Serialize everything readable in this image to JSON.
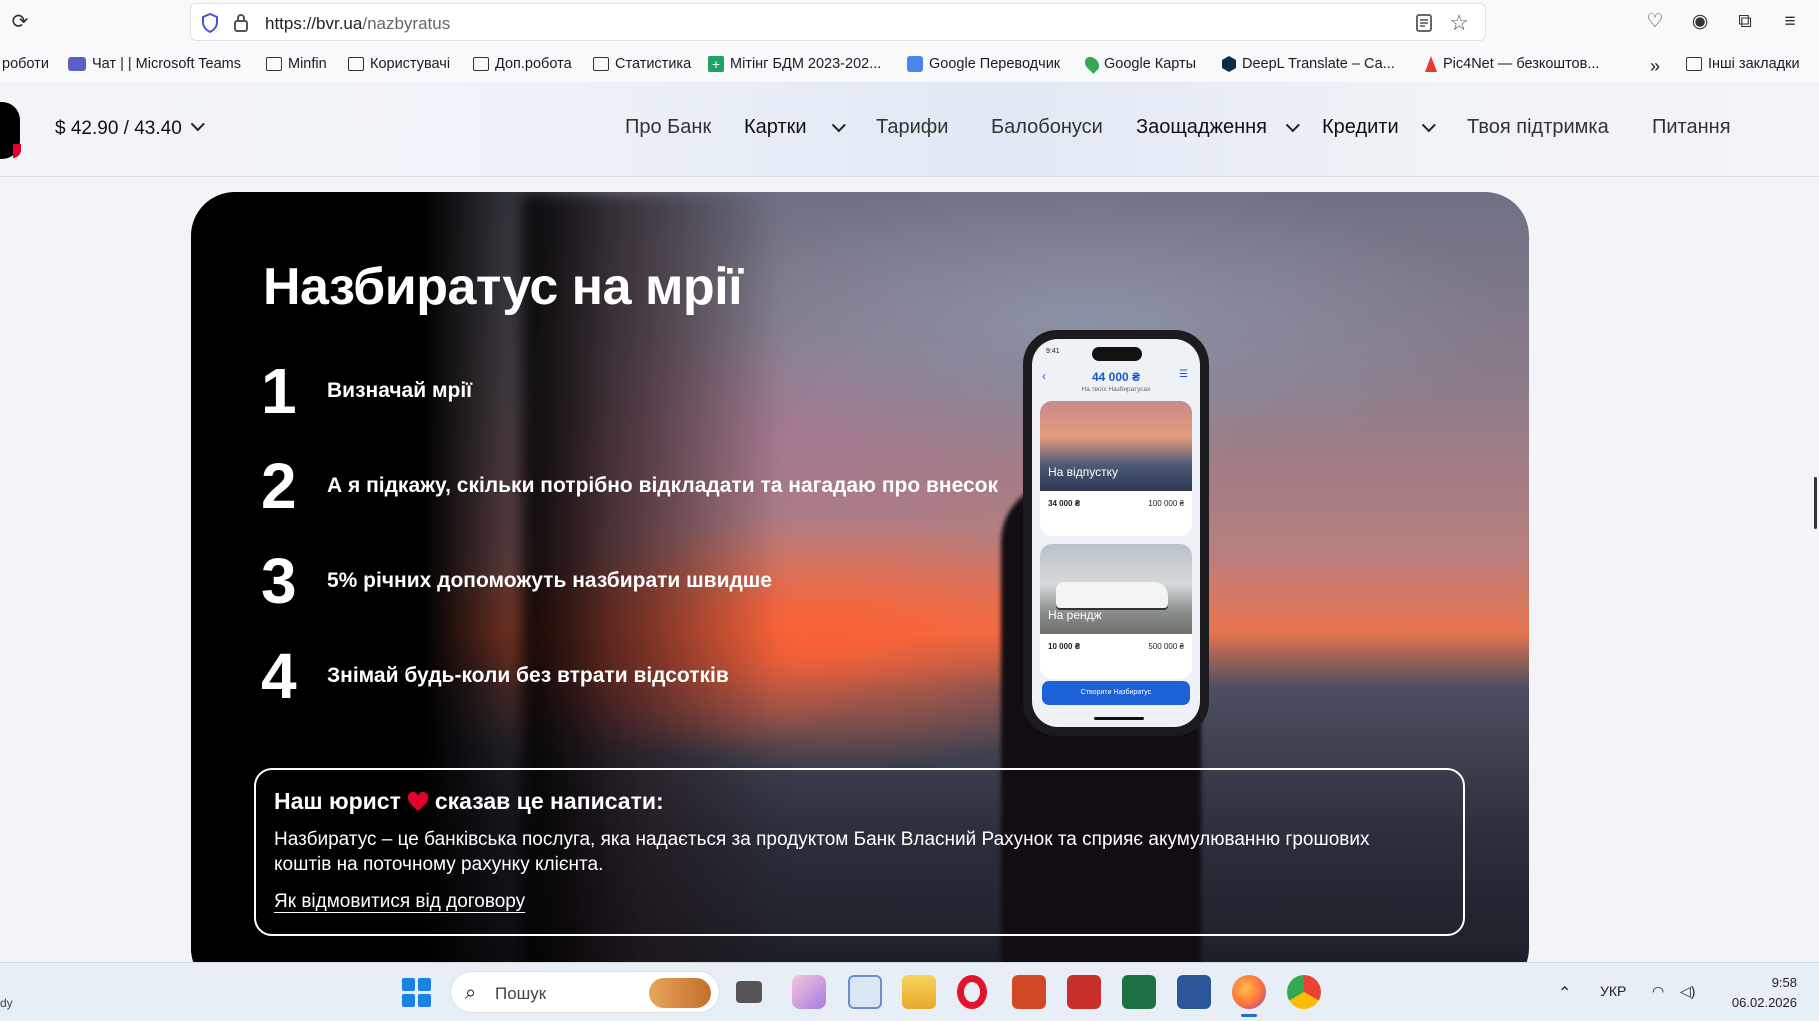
{
  "browser": {
    "url_host": "https://bvr.ua",
    "url_path": "/nazbyratus",
    "bookmarks": [
      {
        "label": "роботи"
      },
      {
        "label": "Чат | | Microsoft Teams"
      },
      {
        "label": "Minfin"
      },
      {
        "label": "Користувачі"
      },
      {
        "label": "Доп.робота"
      },
      {
        "label": "Статистика"
      },
      {
        "label": "Мітінг БДМ 2023-202..."
      },
      {
        "label": "Google Переводчик"
      },
      {
        "label": "Google Карты"
      },
      {
        "label": "DeepL Translate – Са..."
      },
      {
        "label": "Pic4Net — безкоштов..."
      }
    ],
    "other_bookmarks": "Інші закладки"
  },
  "header": {
    "rate": "$ 42.90 / 43.40",
    "nav": [
      {
        "label": "Про Банк"
      },
      {
        "label": "Картки"
      },
      {
        "label": "Тарифи"
      },
      {
        "label": "Балобонуси"
      },
      {
        "label": "Заощадження"
      },
      {
        "label": "Кредити"
      },
      {
        "label": "Твоя підтримка"
      },
      {
        "label": "Питання"
      }
    ]
  },
  "hero": {
    "title": "Назбиратус на мрії",
    "steps": [
      {
        "num": "1",
        "text": "Визначай мрії"
      },
      {
        "num": "2",
        "text": "А я підкажу, скільки потрібно відкладати та нагадаю про внесок"
      },
      {
        "num": "3",
        "text": "5% річних допоможуть назбирати швидше"
      },
      {
        "num": "4",
        "text": "Знімай будь-коли без втрати відсотків"
      }
    ],
    "phone": {
      "time": "9:41",
      "amount": "44 000 ₴",
      "subtitle": "На твоїх Назбиратусах",
      "cards": [
        {
          "title": "На відпустку",
          "saved": "34 000 ₴",
          "goal": "100 000 ₴"
        },
        {
          "title": "На рендж",
          "saved": "10 000 ₴",
          "goal": "500 000 ₴"
        }
      ],
      "button": "Створити Назбиратус"
    }
  },
  "legal": {
    "title_before": "Наш юрист",
    "title_after": "сказав це написати:",
    "body": "Назбиратус – це банківська послуга, яка надається за продуктом Банк Власний Рахунок та сприяє акумулюванню грошових коштів на поточному рахунку клієнта.",
    "link": "Як відмовитися від договору"
  },
  "taskbar": {
    "left_text": "dy",
    "search_placeholder": "Пошук",
    "lang": "УКР",
    "time": "9:58",
    "date": "06.02.2026"
  },
  "colors": {
    "accent_red": "#e3002b",
    "phone_blue": "#1c61d8"
  }
}
